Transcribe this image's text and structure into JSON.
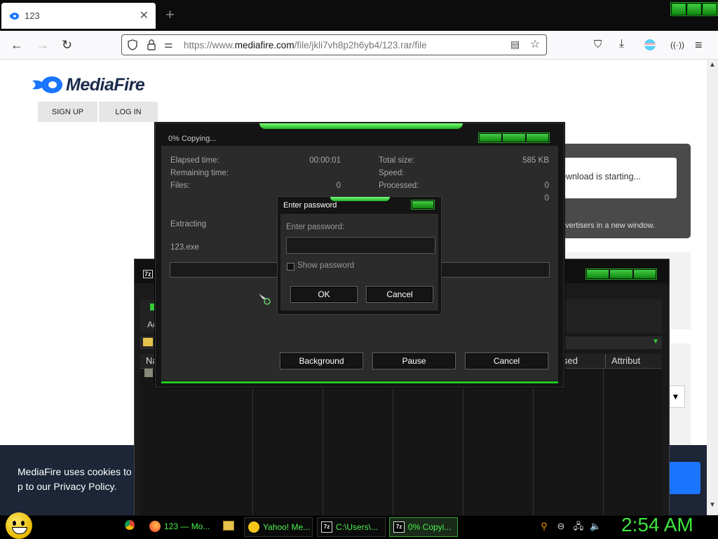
{
  "browser": {
    "tab_title": "123",
    "url_prefix": "https://www.",
    "url_domain": "mediafire.com",
    "url_path": "/file/jkli7vh8p2h6yb4/123.rar/file"
  },
  "page": {
    "logo_text": "MediaFire",
    "signup": "SIGN UP",
    "login": "LOG IN",
    "download_status": "ownload is starting...",
    "advertisers_note": "dvertisers in a new window.",
    "cookie_text": "MediaFire uses cookies to p to our Privacy Policy."
  },
  "file_manager": {
    "toolbar_label": "Ac",
    "columns": [
      "Na",
      "sed",
      "Attribut"
    ]
  },
  "copy_dialog": {
    "title": "0% Copying...",
    "elapsed_label": "Elapsed time:",
    "elapsed_value": "00:00:01",
    "remaining_label": "Remaining time:",
    "files_label": "Files:",
    "files_value": "0",
    "total_size_label": "Total size:",
    "total_size_value": "585 KB",
    "speed_label": "Speed:",
    "processed_label": "Processed:",
    "processed_value": "0",
    "packed_value": "0",
    "extracting_label": "Extracting",
    "current_file": "123.exe",
    "progress_percent": 0,
    "background_btn": "Background",
    "pause_btn": "Pause",
    "cancel_btn": "Cancel"
  },
  "password_dialog": {
    "title": "Enter password",
    "prompt": "Enter password:",
    "password_value": "",
    "show_password_label": "Show password",
    "show_password_checked": false,
    "ok_btn": "OK",
    "cancel_btn": "Cancel"
  },
  "taskbar": {
    "items": [
      "123 — Mo...",
      "Yahoo! Me...",
      "C:\\Users\\...",
      "0% Copyi..."
    ],
    "clock": "2:54 AM"
  },
  "colors": {
    "accent_green": "#3ee63e",
    "mediafire_blue": "#1a75ff",
    "cookie_bg": "#1c2637"
  }
}
